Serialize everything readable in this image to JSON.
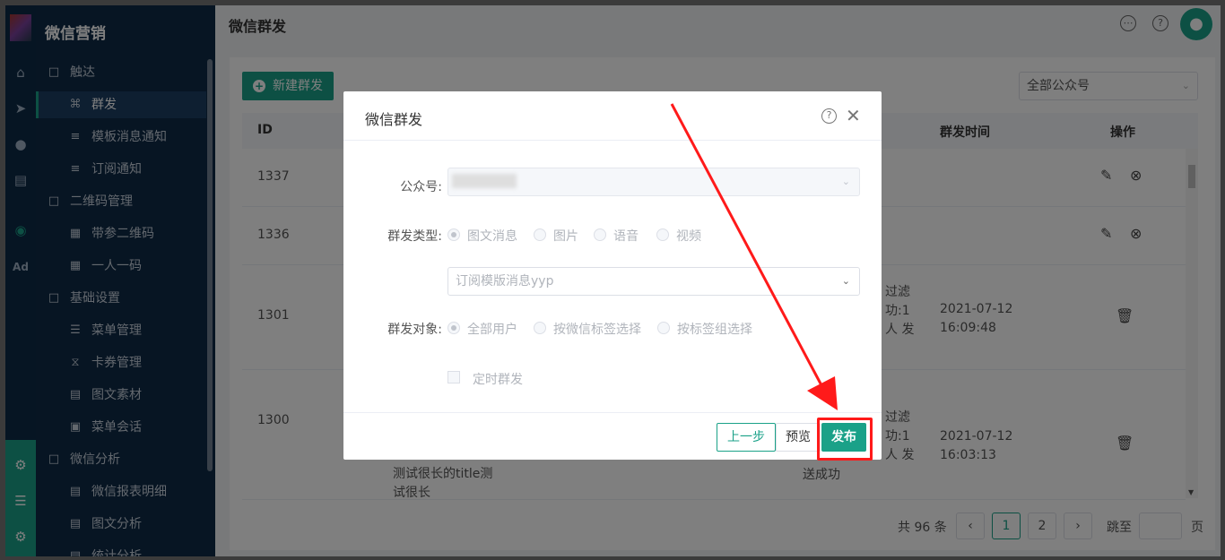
{
  "sidebar": {
    "brand": "微信营销",
    "items": [
      {
        "label": "触达",
        "type": "group",
        "icon": "folder-icon"
      },
      {
        "label": "群发",
        "type": "sub",
        "icon": "broadcast-icon",
        "active": true
      },
      {
        "label": "模板消息通知",
        "type": "sub",
        "icon": "template-icon"
      },
      {
        "label": "订阅通知",
        "type": "sub",
        "icon": "subscribe-icon"
      },
      {
        "label": "二维码管理",
        "type": "group",
        "icon": "folder-icon"
      },
      {
        "label": "带参二维码",
        "type": "sub",
        "icon": "qrcode-icon"
      },
      {
        "label": "一人一码",
        "type": "sub",
        "icon": "qrcode-icon"
      },
      {
        "label": "基础设置",
        "type": "group",
        "icon": "folder-icon"
      },
      {
        "label": "菜单管理",
        "type": "sub",
        "icon": "list-icon"
      },
      {
        "label": "卡券管理",
        "type": "sub",
        "icon": "coupon-icon"
      },
      {
        "label": "图文素材",
        "type": "sub",
        "icon": "article-icon"
      },
      {
        "label": "菜单会话",
        "type": "sub",
        "icon": "chat-icon"
      },
      {
        "label": "微信分析",
        "type": "group",
        "icon": "folder-icon"
      },
      {
        "label": "微信报表明细",
        "type": "sub",
        "icon": "report-icon"
      },
      {
        "label": "图文分析",
        "type": "sub",
        "icon": "report-icon"
      },
      {
        "label": "统计分析",
        "type": "sub",
        "icon": "report-icon"
      }
    ]
  },
  "rail": {
    "ad_label": "Ad"
  },
  "topbar": {
    "title": "微信群发"
  },
  "content": {
    "new_button": "新建群发",
    "account_select": "全部公众号",
    "table": {
      "headers": [
        "ID",
        "群发时间",
        "操作"
      ],
      "rows": [
        {
          "id": "1337",
          "content": [],
          "time": [],
          "actions": [
            "edit",
            "delete"
          ]
        },
        {
          "id": "1336",
          "content": [],
          "time": [],
          "actions": [
            "edit",
            "delete"
          ]
        },
        {
          "id": "1301",
          "content": [
            "过滤",
            "功:1",
            "人 发"
          ],
          "time": [
            "2021-07-12",
            "16:09:48"
          ],
          "actions": [
            "trash"
          ]
        },
        {
          "id": "1300",
          "content": [
            "过滤",
            "功:1",
            "人 发",
            "送成功"
          ],
          "title_text": [
            "测试很长的title测",
            "试很长"
          ],
          "time": [
            "2021-07-12",
            "16:03:13"
          ],
          "actions": [
            "trash"
          ]
        }
      ]
    },
    "pagination": {
      "total": "共 96 条",
      "pages": [
        "1",
        "2"
      ],
      "current": "1",
      "goto_prefix": "跳至",
      "goto_suffix": "页"
    }
  },
  "modal": {
    "title": "微信群发",
    "fields": {
      "account_label": "公众号:",
      "type_label": "群发类型:",
      "type_options": [
        "图文消息",
        "图片",
        "语音",
        "视频"
      ],
      "type_selected": "图文消息",
      "template_value": "订阅模版消息yyp",
      "target_label": "群发对象:",
      "target_options": [
        "全部用户",
        "按微信标签选择",
        "按标签组选择"
      ],
      "target_selected": "全部用户",
      "schedule_label": "定时群发"
    },
    "buttons": {
      "prev": "上一步",
      "preview": "预览",
      "publish": "发布"
    }
  },
  "colors": {
    "accent": "#1aa188",
    "sidebar_bg": "#0f2a46",
    "annotation": "#ff1a1a"
  }
}
